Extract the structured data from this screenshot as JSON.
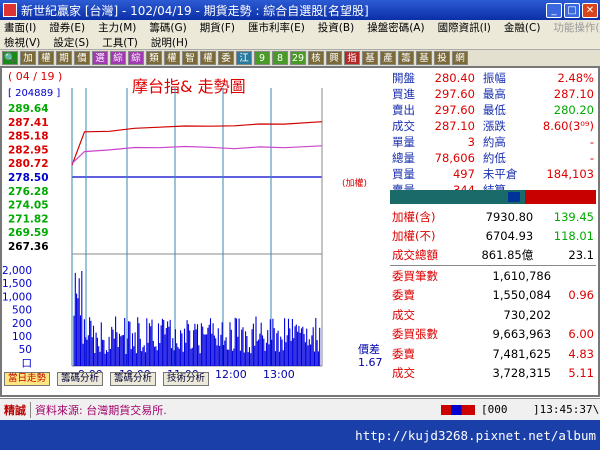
{
  "window": {
    "title": "新世紀贏家 [台灣] - 102/04/19 - 期貨走勢 : 綜合自選股[名望股]"
  },
  "menu": {
    "row1": [
      "畫面(I)",
      "證券(E)",
      "主力(M)",
      "籌碼(G)",
      "期貨(F)",
      "匯市利率(E)",
      "投資(B)",
      "操盤密碼(A)",
      "國際資訊(I)",
      "金融(C)",
      "功能操作(F)"
    ],
    "row1_dim": "功能操作(F)",
    "row2": [
      "檢視(V)",
      "設定(S)",
      "工具(T)",
      "說明(H)"
    ]
  },
  "toolbar": {
    "buttons": [
      {
        "label": "🔍",
        "color": "#1a8a1a"
      },
      {
        "label": "加",
        "color": "#7a6a3a"
      },
      {
        "label": "權",
        "color": "#7a6a3a"
      },
      {
        "label": "期",
        "color": "#7a6a3a"
      },
      {
        "label": "價",
        "color": "#7a6a3a"
      },
      {
        "label": "選",
        "color": "#a03ab0"
      },
      {
        "label": "綜",
        "color": "#a03ab0"
      },
      {
        "label": "綜",
        "color": "#a03ab0"
      },
      {
        "label": "類",
        "color": "#7a6a3a"
      },
      {
        "label": "權",
        "color": "#7a6a3a"
      },
      {
        "label": "智",
        "color": "#7a6a3a"
      },
      {
        "label": "權",
        "color": "#7a6a3a"
      },
      {
        "label": "委",
        "color": "#7a6a3a"
      },
      {
        "label": "江",
        "color": "#2a7aa0"
      },
      {
        "label": "9",
        "color": "#4a9a2a"
      },
      {
        "label": "8",
        "color": "#4a9a2a"
      },
      {
        "label": "29",
        "color": "#4a9a2a"
      },
      {
        "label": "核",
        "color": "#7a6a3a"
      },
      {
        "label": "興",
        "color": "#7a6a3a"
      },
      {
        "label": "指",
        "color": "#b02a2a"
      },
      {
        "label": "基",
        "color": "#7a6a3a"
      },
      {
        "label": "產",
        "color": "#7a6a3a"
      },
      {
        "label": "籌",
        "color": "#7a6a3a"
      },
      {
        "label": "基",
        "color": "#7a6a3a"
      },
      {
        "label": "投",
        "color": "#7a6a3a"
      },
      {
        "label": "網",
        "color": "#7a6a3a"
      }
    ]
  },
  "chart": {
    "date": "( 04 / 19 )",
    "code": "[ 204889 ]",
    "title": "摩台指&  走勢圖",
    "ref_label": "(加權)",
    "basis_label": "價差",
    "basis_value": "1.67",
    "price_ticks": [
      {
        "v": "289.64",
        "c": "#0a0"
      },
      {
        "v": "287.41",
        "c": "#d00"
      },
      {
        "v": "285.18",
        "c": "#d00"
      },
      {
        "v": "282.95",
        "c": "#d00"
      },
      {
        "v": "280.72",
        "c": "#d00"
      },
      {
        "v": "278.50",
        "c": "#00c"
      },
      {
        "v": "276.28",
        "c": "#0a0"
      },
      {
        "v": "274.05",
        "c": "#0a0"
      },
      {
        "v": "271.82",
        "c": "#0a0"
      },
      {
        "v": "269.59",
        "c": "#0a0"
      },
      {
        "v": "267.36",
        "c": "#000"
      }
    ],
    "vol_ticks": [
      "2,000",
      "1,500",
      "1,000",
      "500",
      "200",
      "100",
      "50",
      "口"
    ],
    "time_ticks": [
      "9:00",
      "10:00",
      "11:00",
      "12:00",
      "13:00"
    ],
    "tabs": [
      "當日走勢",
      "籌碼分析",
      "籌碼分析",
      "技術分析"
    ],
    "colors": {
      "price": "#d00000",
      "ref": "#cc44cc",
      "volume": "#0000dd",
      "grid": "#3a8ab0"
    }
  },
  "chart_data": {
    "type": "line",
    "x": [
      "8:45",
      "9:00",
      "9:30",
      "10:00",
      "10:30",
      "11:00",
      "11:30",
      "12:00",
      "12:30",
      "13:00",
      "13:45"
    ],
    "series": [
      {
        "name": "",
        "values": [
          280.4,
          285.8,
          286.0,
          286.3,
          286.6,
          286.6,
          286.7,
          286.9,
          287.0,
          287.1,
          287.3
        ]
      },
      {
        "name": "加權",
        "values": [
          280.7,
          282.6,
          283.0,
          283.2,
          283.3,
          283.3,
          283.3,
          283.2,
          283.3,
          283.3,
          283.4
        ]
      }
    ],
    "ylim": [
      267.36,
      289.64
    ]
  },
  "quotes": {
    "rows": [
      {
        "l1": "開盤",
        "v1": "280.40",
        "c1": "#d00",
        "l2": "振幅",
        "v2": "2.48%",
        "c2": "#d00"
      },
      {
        "l1": "買進",
        "v1": "297.60",
        "c1": "#d00",
        "l2": "最高",
        "v2": "287.10",
        "c2": "#d00"
      },
      {
        "l1": "賣出",
        "v1": "297.60",
        "c1": "#d00",
        "l2": "最低",
        "v2": "280.20",
        "c2": "#0a0"
      },
      {
        "l1": "成交",
        "v1": "287.10",
        "c1": "#d00",
        "l2": "漲跌",
        "v2": "8.60(3⁰⁹)",
        "c2": "#d00"
      },
      {
        "l1": "單量",
        "v1": "3",
        "c1": "#d00",
        "l2": "約高",
        "v2": "-",
        "c2": "#d00"
      },
      {
        "l1": "總量",
        "v1": "78,606",
        "c1": "#d00",
        "l2": "約低",
        "v2": "-",
        "c2": "#d00"
      },
      {
        "l1": "買量",
        "v1": "497",
        "c1": "#d00",
        "l2": "未平倉",
        "v2": "184,103",
        "c2": "#d00"
      },
      {
        "l1": "賣量",
        "v1": "344",
        "c1": "#d00",
        "l2": "結算",
        "v2": "-",
        "c2": "#d00"
      }
    ]
  },
  "index": {
    "rows": [
      {
        "label": "加權(含)",
        "v": "7930.80",
        "chg": "139.45"
      },
      {
        "label": "加權(不)",
        "v": "6704.93",
        "chg": "118.01"
      },
      {
        "label": "成交總額",
        "v": "861.85億",
        "chg": "23.1"
      }
    ]
  },
  "orders": {
    "rows": [
      {
        "label": "委買筆數",
        "v": "1,610,786",
        "chg": ""
      },
      {
        "label": "委賣",
        "v": "1,550,084",
        "chg": "0.96"
      },
      {
        "label": "成交",
        "v": "730,202",
        "chg": ""
      },
      {
        "label": "委買張數",
        "v": "9,663,963",
        "chg": "6.00"
      },
      {
        "label": "委賣",
        "v": "7,481,625",
        "chg": "4.83"
      },
      {
        "label": "成交",
        "v": "3,728,315",
        "chg": "5.11"
      }
    ]
  },
  "status": {
    "tag": "精誠",
    "source": "資料來源: 台灣期貨交易所.",
    "counter": "[000",
    "time": "]13:45:37\\"
  },
  "watermark": "http://kujd3268.pixnet.net/album"
}
